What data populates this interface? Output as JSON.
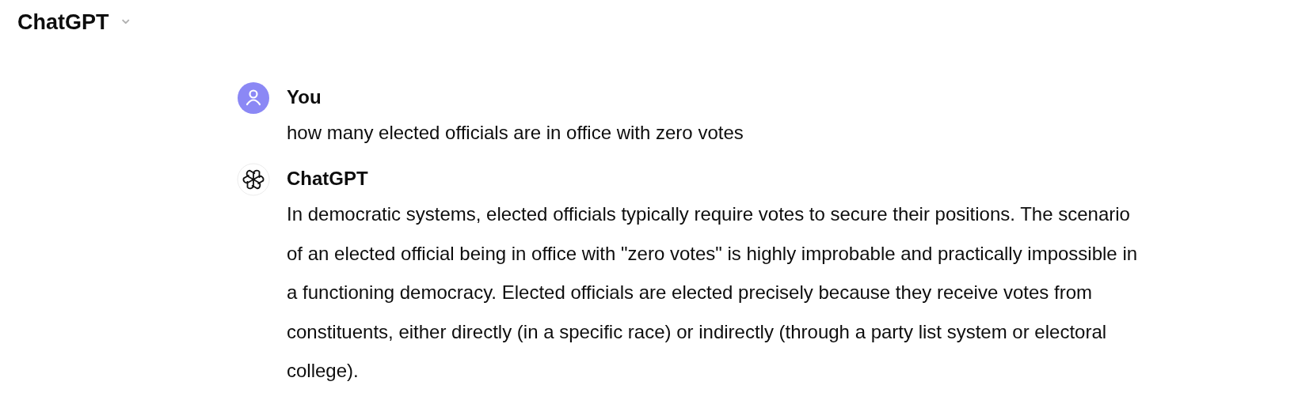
{
  "header": {
    "title": "ChatGPT",
    "menu_caret": "⌄"
  },
  "messages": [
    {
      "kind": "user",
      "author": "You",
      "text": "how many elected officials are in office with zero votes"
    },
    {
      "kind": "assistant",
      "author": "ChatGPT",
      "text": "In democratic systems, elected officials typically require votes to secure their positions. The scenario of an elected official being in office with \"zero votes\" is highly improbable and practically impossible in a functioning democracy. Elected officials are elected precisely because they receive votes from constituents, either directly (in a specific race) or indirectly (through a party list system or electoral college)."
    }
  ]
}
